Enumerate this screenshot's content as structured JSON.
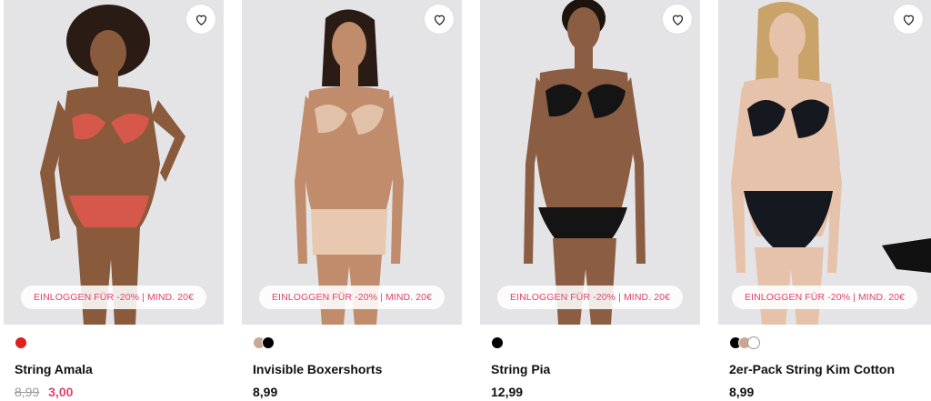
{
  "products": [
    {
      "name": "String Amala",
      "promo": "EINLOGGEN FÜR -20% | MIND. 20€",
      "old_price": "8,99",
      "price": "3,00",
      "swatches": [
        "#e0201c"
      ],
      "wishlist_icon": "heart-outline-icon"
    },
    {
      "name": "Invisible Boxershorts",
      "promo": "EINLOGGEN FÜR -20% | MIND. 20€",
      "price": "8,99",
      "swatches": [
        "#c9a893",
        "#000000"
      ],
      "wishlist_icon": "heart-outline-icon"
    },
    {
      "name": "String Pia",
      "promo": "EINLOGGEN FÜR -20% | MIND. 20€",
      "price": "12,99",
      "swatches": [
        "#000000"
      ],
      "wishlist_icon": "heart-outline-icon"
    },
    {
      "name": "2er-Pack String Kim Cotton",
      "promo": "EINLOGGEN FÜR -20% | MIND. 20€",
      "price": "8,99",
      "swatches": [
        "#000000",
        "#c9a893",
        "#ffffff"
      ],
      "wishlist_icon": "heart-outline-icon"
    }
  ],
  "colors": {
    "sale": "#e0426e",
    "strike": "#9a9a9a",
    "photo_bg": "#e4e4e6"
  }
}
